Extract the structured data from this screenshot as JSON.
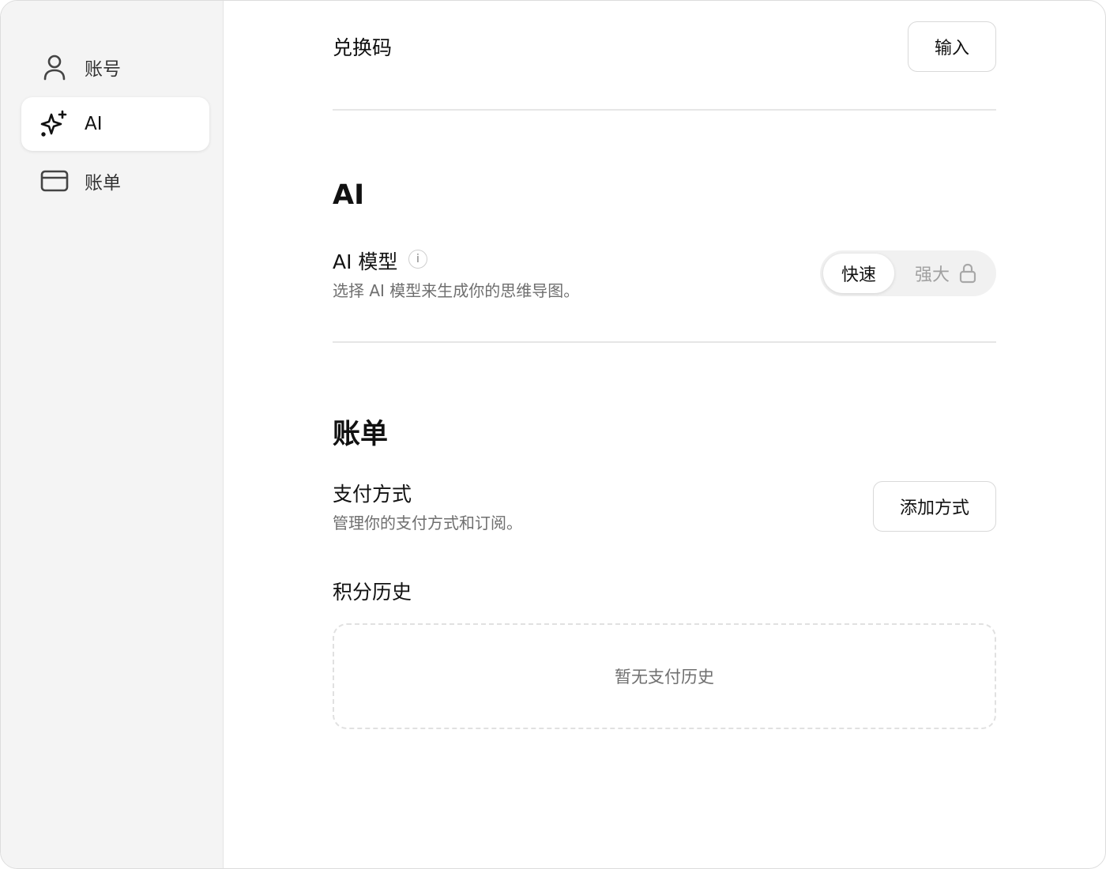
{
  "sidebar": {
    "items": [
      {
        "label": "账号",
        "icon": "user-icon",
        "active": false
      },
      {
        "label": "AI",
        "icon": "sparkles-icon",
        "active": true
      },
      {
        "label": "账单",
        "icon": "credit-card-icon",
        "active": false
      }
    ]
  },
  "redeem": {
    "title": "兑换码",
    "button_label": "输入"
  },
  "ai_section": {
    "heading": "AI",
    "model_title": "AI 模型",
    "info_icon": "i",
    "model_desc": "选择 AI 模型来生成你的思维导图。",
    "options": [
      {
        "label": "快速",
        "selected": true,
        "locked": false
      },
      {
        "label": "强大",
        "selected": false,
        "locked": true
      }
    ]
  },
  "billing_section": {
    "heading": "账单",
    "payment_title": "支付方式",
    "payment_desc": "管理你的支付方式和订阅。",
    "add_button_label": "添加方式",
    "history_title": "积分历史",
    "empty_history": "暂无支付历史"
  }
}
